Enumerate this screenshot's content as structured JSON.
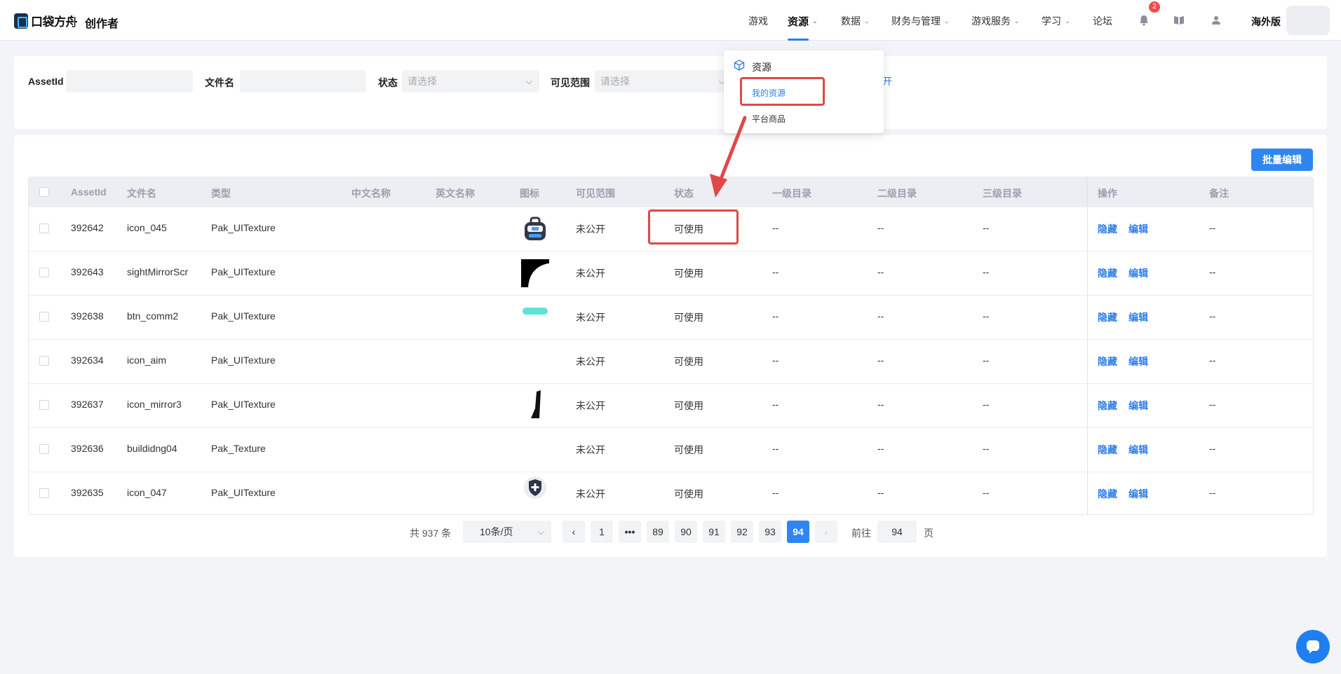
{
  "header": {
    "logo_text": "口袋方舟",
    "brand_sub": "创作者",
    "nav": [
      {
        "label": "游戏",
        "has_chevron": false
      },
      {
        "label": "资源",
        "has_chevron": true,
        "active": true
      },
      {
        "label": "数据",
        "has_chevron": true
      },
      {
        "label": "财务与管理",
        "has_chevron": true
      },
      {
        "label": "游戏服务",
        "has_chevron": true
      },
      {
        "label": "学习",
        "has_chevron": true
      },
      {
        "label": "论坛",
        "has_chevron": false
      }
    ],
    "notification_count": "2",
    "region": "海外版"
  },
  "dropdown": {
    "title": "资源",
    "items": [
      {
        "label": "我的资源",
        "selected": true
      },
      {
        "label": "平台商品",
        "selected": false
      }
    ]
  },
  "filters": {
    "assetid_label": "AssetId",
    "filename_label": "文件名",
    "status_label": "状态",
    "status_placeholder": "请选择",
    "visibility_label": "可见范围",
    "visibility_placeholder": "请选择",
    "trailing_link": "开"
  },
  "toolbar": {
    "batch_edit_label": "批量编辑"
  },
  "table": {
    "headers": {
      "assetid": "AssetId",
      "filename": "文件名",
      "type": "类型",
      "cn_name": "中文名称",
      "en_name": "英文名称",
      "icon": "图标",
      "visibility": "可见范围",
      "status": "状态",
      "cat1": "一级目录",
      "cat2": "二级目录",
      "cat3": "三级目录",
      "actions": "操作",
      "remark": "备注"
    },
    "rows": [
      {
        "assetid": "392642",
        "filename": "icon_045",
        "type": "Pak_UITexture",
        "icon": "backpack-icon",
        "visibility": "未公开",
        "status": "可使用",
        "cat1": "--",
        "cat2": "--",
        "cat3": "--",
        "hide": "隐藏",
        "edit": "编辑",
        "remark": "--"
      },
      {
        "assetid": "392643",
        "filename": "sightMirrorScr",
        "type": "Pak_UITexture",
        "icon": "mirror-quadrant-icon",
        "visibility": "未公开",
        "status": "可使用",
        "cat1": "--",
        "cat2": "--",
        "cat3": "--",
        "hide": "隐藏",
        "edit": "编辑",
        "remark": "--"
      },
      {
        "assetid": "392638",
        "filename": "btn_comm2",
        "type": "Pak_UITexture",
        "icon": "cyan-pill-icon",
        "visibility": "未公开",
        "status": "可使用",
        "cat1": "--",
        "cat2": "--",
        "cat3": "--",
        "hide": "隐藏",
        "edit": "编辑",
        "remark": "--"
      },
      {
        "assetid": "392634",
        "filename": "icon_aim",
        "type": "Pak_UITexture",
        "icon": "",
        "visibility": "未公开",
        "status": "可使用",
        "cat1": "--",
        "cat2": "--",
        "cat3": "--",
        "hide": "隐藏",
        "edit": "编辑",
        "remark": "--"
      },
      {
        "assetid": "392637",
        "filename": "icon_mirror3",
        "type": "Pak_UITexture",
        "icon": "black-shard-icon",
        "visibility": "未公开",
        "status": "可使用",
        "cat1": "--",
        "cat2": "--",
        "cat3": "--",
        "hide": "隐藏",
        "edit": "编辑",
        "remark": "--"
      },
      {
        "assetid": "392636",
        "filename": "buildidng04",
        "type": "Pak_Texture",
        "icon": "",
        "visibility": "未公开",
        "status": "可使用",
        "cat1": "--",
        "cat2": "--",
        "cat3": "--",
        "hide": "隐藏",
        "edit": "编辑",
        "remark": "--"
      },
      {
        "assetid": "392635",
        "filename": "icon_047",
        "type": "Pak_UITexture",
        "icon": "shield-plus-icon",
        "visibility": "未公开",
        "status": "可使用",
        "cat1": "--",
        "cat2": "--",
        "cat3": "--",
        "hide": "隐藏",
        "edit": "编辑",
        "remark": "--"
      }
    ]
  },
  "pagination": {
    "total": "共 937 条",
    "page_size": "10条/页",
    "pages": [
      "1",
      "•••",
      "89",
      "90",
      "91",
      "92",
      "93",
      "94"
    ],
    "current": "94",
    "goto_label": "前往",
    "goto_value": "94",
    "page_suffix": "页"
  },
  "colors": {
    "accent": "#2f86f1",
    "highlight": "#e04848",
    "badge": "#f14b4b"
  }
}
